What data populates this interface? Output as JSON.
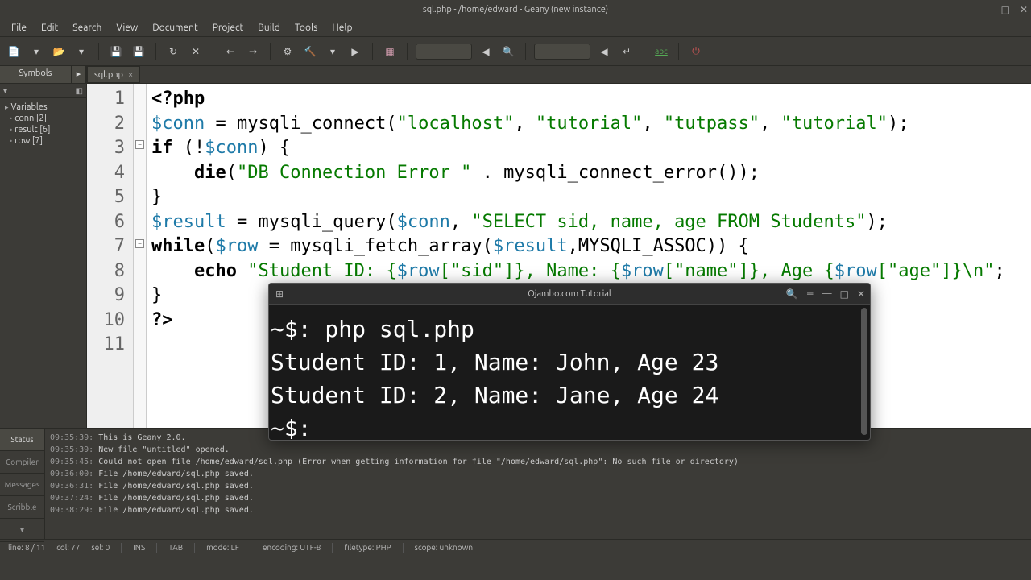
{
  "window": {
    "title": "sql.php - /home/edward - Geany (new instance)"
  },
  "menu": [
    "File",
    "Edit",
    "Search",
    "View",
    "Document",
    "Project",
    "Build",
    "Tools",
    "Help"
  ],
  "sidebar": {
    "tab": "Symbols",
    "items": [
      "Variables",
      "conn [2]",
      "result [6]",
      "row [7]"
    ]
  },
  "document": {
    "tab_name": "sql.php",
    "lines": [
      "1",
      "2",
      "3",
      "4",
      "5",
      "6",
      "7",
      "8",
      "9",
      "10",
      "11"
    ]
  },
  "code": {
    "l1_open": "<?php",
    "l2_var": "$conn",
    "l2_eq": " = ",
    "l2_fn": "mysqli_connect",
    "l2_p1": "(",
    "l2_s1": "\"localhost\"",
    "l2_c1": ", ",
    "l2_s2": "\"tutorial\"",
    "l2_c2": ", ",
    "l2_s3": "\"tutpass\"",
    "l2_c3": ", ",
    "l2_s4": "\"tutorial\"",
    "l2_end": ");",
    "l3_if": "if",
    "l3_rest1": " (!",
    "l3_var": "$conn",
    "l3_rest2": ") {",
    "l4_indent": "    ",
    "l4_die": "die",
    "l4_p": "(",
    "l4_s": "\"DB Connection Error \"",
    "l4_dot": " . ",
    "l4_fn": "mysqli_connect_error",
    "l4_end": "());",
    "l5": "}",
    "l6_var": "$result",
    "l6_eq": " = ",
    "l6_fn": "mysqli_query",
    "l6_p": "(",
    "l6_v2": "$conn",
    "l6_c": ", ",
    "l6_s": "\"SELECT sid, name, age FROM Students\"",
    "l6_end": ");",
    "l7_while": "while",
    "l7_p1": "(",
    "l7_v1": "$row",
    "l7_eq": " = ",
    "l7_fn": "mysqli_fetch_array",
    "l7_p2": "(",
    "l7_v2": "$result",
    "l7_c": ",",
    "l7_const": "MYSQLI_ASSOC",
    "l7_end": ")) {",
    "l8_indent": "    ",
    "l8_echo": "echo",
    "l8_sp": " ",
    "l8_s1": "\"Student ID: ",
    "l8_b1": "{",
    "l8_v1": "$row",
    "l8_k1": "[\"sid\"]",
    "l8_b1e": "}",
    "l8_s2": ", Name: ",
    "l8_b2": "{",
    "l8_v2": "$row",
    "l8_k2": "[\"name\"]",
    "l8_b2e": "}",
    "l8_s3": ", Age ",
    "l8_b3": "{",
    "l8_v3": "$row",
    "l8_k3": "[\"age\"]",
    "l8_b3e": "}",
    "l8_s4": "\\n\"",
    "l8_end": ";",
    "l9": "}",
    "l10": "?>",
    "l11": ""
  },
  "messages": {
    "tabs": [
      "Status",
      "Compiler",
      "Messages",
      "Scribble"
    ],
    "lines": [
      {
        "ts": "09:35:39:",
        "msg": " This is Geany 2.0."
      },
      {
        "ts": "09:35:39:",
        "msg": " New file \"untitled\" opened."
      },
      {
        "ts": "09:35:45:",
        "msg": " Could not open file /home/edward/sql.php (Error when getting information for file \"/home/edward/sql.php\": No such file or directory)"
      },
      {
        "ts": "09:36:00:",
        "msg": " File /home/edward/sql.php saved."
      },
      {
        "ts": "09:36:31:",
        "msg": " File /home/edward/sql.php saved."
      },
      {
        "ts": "09:37:24:",
        "msg": " File /home/edward/sql.php saved."
      },
      {
        "ts": "09:38:29:",
        "msg": " File /home/edward/sql.php saved."
      }
    ]
  },
  "statusbar": {
    "pos": "line: 8 / 11",
    "col": "col: 77",
    "sel": "sel: 0",
    "ins": "INS",
    "tab": "TAB",
    "mode": "mode: LF",
    "enc": "encoding: UTF-8",
    "ft": "filetype: PHP",
    "scope": "scope: unknown"
  },
  "terminal": {
    "title": "Ojambo.com Tutorial",
    "lines": [
      "~$: php sql.php",
      "Student ID: 1, Name: John, Age 23",
      "Student ID: 2, Name: Jane, Age 24",
      "~$: "
    ]
  }
}
